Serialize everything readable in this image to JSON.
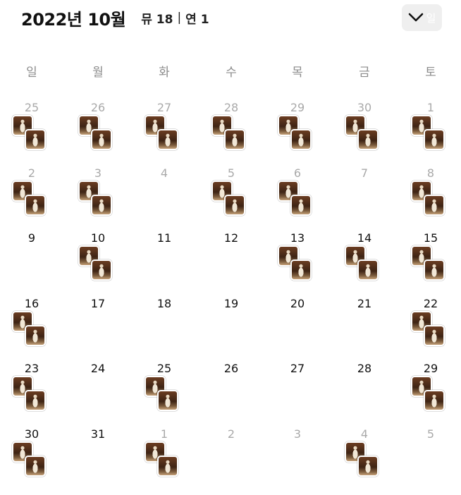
{
  "header": {
    "month_title": "2022년 10월",
    "count_a": "뮤 18",
    "separator": "|",
    "count_b": "연 1",
    "toggle_label": "일",
    "toggle_icon": "chevron-down-icon"
  },
  "weekdays": [
    "일",
    "월",
    "화",
    "수",
    "목",
    "금",
    "토"
  ],
  "weeks": [
    [
      {
        "day": "25",
        "other": true,
        "photo": true
      },
      {
        "day": "26",
        "other": true,
        "photo": true
      },
      {
        "day": "27",
        "other": true,
        "photo": true
      },
      {
        "day": "28",
        "other": true,
        "photo": true
      },
      {
        "day": "29",
        "other": true,
        "photo": true
      },
      {
        "day": "30",
        "other": true,
        "photo": true
      },
      {
        "day": "1",
        "other": true,
        "photo": true
      }
    ],
    [
      {
        "day": "2",
        "other": true,
        "photo": true
      },
      {
        "day": "3",
        "other": true,
        "photo": true
      },
      {
        "day": "4",
        "other": true,
        "photo": false
      },
      {
        "day": "5",
        "other": true,
        "photo": true
      },
      {
        "day": "6",
        "other": true,
        "photo": true
      },
      {
        "day": "7",
        "other": true,
        "photo": false
      },
      {
        "day": "8",
        "other": true,
        "photo": true
      }
    ],
    [
      {
        "day": "9",
        "other": false,
        "photo": false
      },
      {
        "day": "10",
        "other": false,
        "photo": true
      },
      {
        "day": "11",
        "other": false,
        "photo": false
      },
      {
        "day": "12",
        "other": false,
        "photo": false
      },
      {
        "day": "13",
        "other": false,
        "photo": true
      },
      {
        "day": "14",
        "other": false,
        "photo": true
      },
      {
        "day": "15",
        "other": false,
        "photo": true
      }
    ],
    [
      {
        "day": "16",
        "other": false,
        "photo": true
      },
      {
        "day": "17",
        "other": false,
        "photo": false
      },
      {
        "day": "18",
        "other": false,
        "photo": false
      },
      {
        "day": "19",
        "other": false,
        "photo": false
      },
      {
        "day": "20",
        "other": false,
        "photo": false
      },
      {
        "day": "21",
        "other": false,
        "photo": false
      },
      {
        "day": "22",
        "other": false,
        "photo": true
      }
    ],
    [
      {
        "day": "23",
        "other": false,
        "photo": true
      },
      {
        "day": "24",
        "other": false,
        "photo": false
      },
      {
        "day": "25",
        "other": false,
        "photo": true
      },
      {
        "day": "26",
        "other": false,
        "photo": false
      },
      {
        "day": "27",
        "other": false,
        "photo": false
      },
      {
        "day": "28",
        "other": false,
        "photo": false
      },
      {
        "day": "29",
        "other": false,
        "photo": true
      }
    ],
    [
      {
        "day": "30",
        "other": false,
        "photo": true
      },
      {
        "day": "31",
        "other": false,
        "photo": false
      },
      {
        "day": "1",
        "other": true,
        "photo": true
      },
      {
        "day": "2",
        "other": true,
        "photo": false
      },
      {
        "day": "3",
        "other": true,
        "photo": false
      },
      {
        "day": "4",
        "other": true,
        "photo": true
      },
      {
        "day": "5",
        "other": true,
        "photo": false
      }
    ]
  ]
}
